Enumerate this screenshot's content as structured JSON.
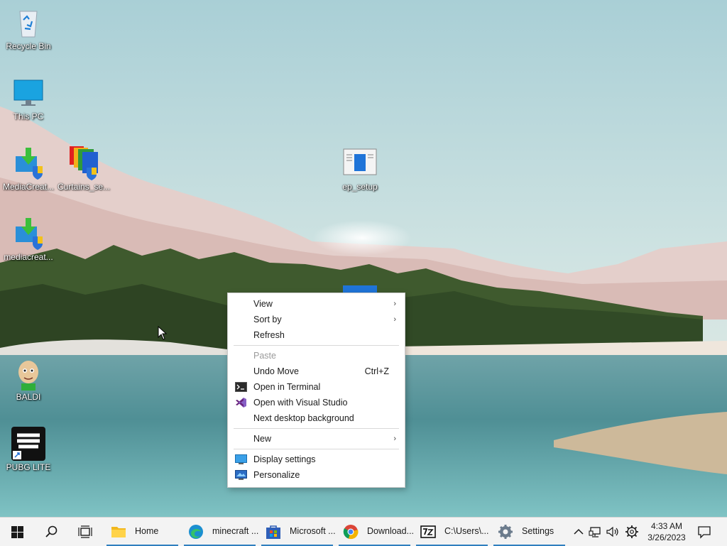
{
  "desktop": {
    "icons": [
      {
        "label": "Recycle Bin",
        "icon": "recycle-bin-icon"
      },
      {
        "label": "This PC",
        "icon": "this-pc-icon"
      },
      {
        "label": "MediaCreat...",
        "icon": "media-creation-tool-icon"
      },
      {
        "label": "Curtains_se...",
        "icon": "curtains-setup-icon"
      },
      {
        "label": "ep_setup",
        "icon": "ep-setup-icon"
      },
      {
        "label": "mediacreat...",
        "icon": "media-creation-tool-icon"
      },
      {
        "label": "BALDI",
        "icon": "baldi-icon"
      },
      {
        "label": "PUBG LITE",
        "icon": "pubg-lite-icon"
      }
    ]
  },
  "context_menu": {
    "view": "View",
    "sort_by": "Sort by",
    "refresh": "Refresh",
    "paste": "Paste",
    "undo_move": "Undo Move",
    "undo_shortcut": "Ctrl+Z",
    "open_terminal": "Open in Terminal",
    "open_vs": "Open with Visual Studio",
    "next_bg": "Next desktop background",
    "new": "New",
    "display_settings": "Display settings",
    "personalize": "Personalize"
  },
  "taskbar": {
    "apps": [
      {
        "label": "Home",
        "icon": "file-explorer-icon"
      },
      {
        "label": "minecraft ...",
        "icon": "edge-icon"
      },
      {
        "label": "Microsoft ...",
        "icon": "microsoft-store-icon"
      },
      {
        "label": "Download...",
        "icon": "chrome-icon"
      },
      {
        "label": "C:\\Users\\...",
        "icon": "7zip-icon"
      },
      {
        "label": "Settings",
        "icon": "settings-icon"
      }
    ],
    "time": "4:33 AM",
    "date": "3/26/2023"
  },
  "colors": {
    "accent": "#2f7fbf",
    "taskbar_bg": "#f3f3f3"
  }
}
